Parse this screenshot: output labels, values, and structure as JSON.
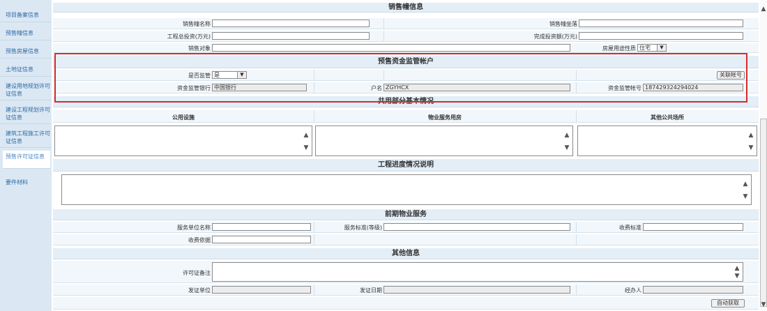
{
  "sidebar": {
    "items": [
      {
        "label": "项目备案信息"
      },
      {
        "label": "预售幢信息"
      },
      {
        "label": "预售房屋信息"
      },
      {
        "label": "土地证信息"
      },
      {
        "label": "建设用地规划许可证信息"
      },
      {
        "label": "建设工程规划许可证信息"
      },
      {
        "label": "建筑工程施工许可证信息"
      },
      {
        "label": "预售许可证信息"
      },
      {
        "label": "要件材料"
      }
    ]
  },
  "sales": {
    "title": "销售幢信息",
    "name_label": "销售幢名称",
    "location_label": "销售幢坐落",
    "total_invest_label": "工程总投资(万元)",
    "done_invest_label": "完成投资额(万元)",
    "target_label": "销售对象",
    "usage_label": "房屋用途性质",
    "usage_value": "住宅"
  },
  "escrow": {
    "title": "预售资金监管帐户",
    "supervised_label": "是否监管",
    "supervised_value": "是",
    "link_button": "关联帐号",
    "bank_label": "资金监管银行",
    "bank_value": "中国银行",
    "account_name_label": "户名",
    "account_name_value": "ZGYHCX",
    "account_no_label": "资金监管帐号",
    "account_no_value": "187429324294024"
  },
  "public": {
    "title": "共用部分基本情况",
    "col1": "公用设施",
    "col2": "物业服务用房",
    "col3": "其他公共场所"
  },
  "progress": {
    "title": "工程进度情况说明"
  },
  "property": {
    "title": "前期物业服务",
    "unit_label": "服务单位名称",
    "standard_label": "服务标准(等级)",
    "fee_label": "收费标准",
    "basis_label": "收费依据"
  },
  "other": {
    "title": "其他信息",
    "remark_label": "许可证备注",
    "issuer_label": "发证单位",
    "issue_date_label": "发证日期",
    "handler_label": "经办人",
    "auto_button": "自动获取"
  },
  "icons": {
    "scroll_up": "▲",
    "scroll_down": "▼"
  }
}
